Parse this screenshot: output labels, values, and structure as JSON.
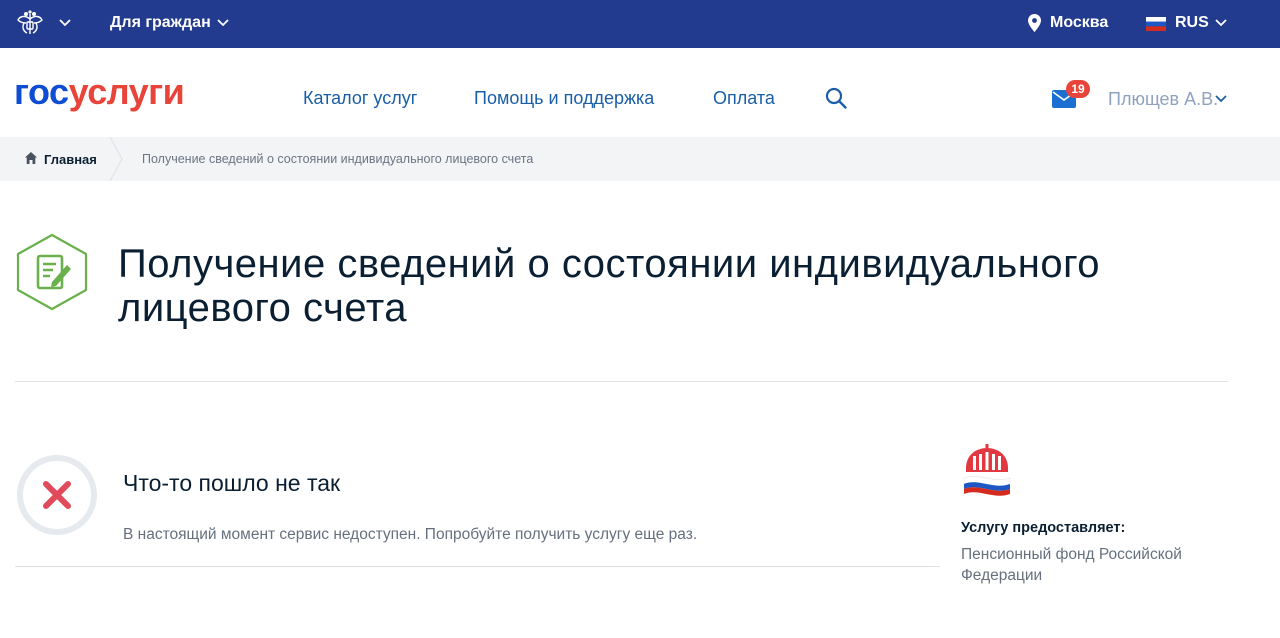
{
  "topbar": {
    "citizens_label": "Для граждан",
    "city": "Москва",
    "lang": "RUS"
  },
  "header": {
    "logo_gos": "гос",
    "logo_uslugi": "услуги",
    "nav": [
      {
        "label": "Каталог услуг"
      },
      {
        "label": "Помощь и поддержка"
      },
      {
        "label": "Оплата"
      }
    ],
    "mail_count": "19",
    "user_name": "Плющев А.В."
  },
  "breadcrumbs": {
    "home": "Главная",
    "current": "Получение сведений о состоянии индивидуального лицевого счета"
  },
  "page": {
    "title": "Получение сведений о состоянии индивидуального лицевого счета"
  },
  "error": {
    "title": "Что-то пошло не так",
    "message": "В настоящий момент сервис недоступен. Попробуйте получить услугу еще раз."
  },
  "provider": {
    "label": "Услугу предоставляет:",
    "name": "Пенсионный фонд Российской Федерации"
  },
  "colors": {
    "topbar": "#233b8f",
    "logo_blue": "#0d4cd3",
    "logo_red": "#e8443a",
    "nav_link": "#1a5ea8",
    "icon_green": "#6ab04c",
    "error_red": "#e04a5a"
  },
  "icons": {
    "emblem": "russia-emblem-icon",
    "location": "map-pin-icon",
    "flag": "russia-flag-icon",
    "search": "search-icon",
    "mail": "mail-icon",
    "home": "home-icon",
    "service": "document-edit-icon",
    "error": "error-cross-icon",
    "provider": "pfr-logo-icon"
  }
}
